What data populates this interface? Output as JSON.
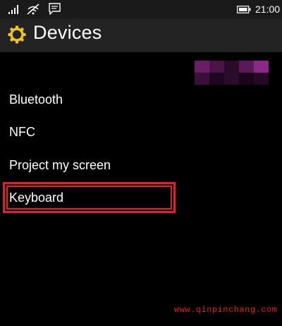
{
  "status_bar": {
    "time": "21:00",
    "icons": [
      "signal-icon",
      "wifi-icon",
      "message-icon",
      "battery-icon"
    ]
  },
  "header": {
    "title": "Devices",
    "icon": "gear-icon",
    "accent_color": "#f5c518"
  },
  "menu": {
    "items": [
      {
        "label": "Bluetooth"
      },
      {
        "label": "NFC"
      },
      {
        "label": "Project my screen"
      },
      {
        "label": "Keyboard",
        "highlighted": true
      }
    ]
  },
  "annotation": {
    "highlight_color": "#e0202a"
  },
  "watermark": {
    "text": "www.qinpinchang.com"
  }
}
